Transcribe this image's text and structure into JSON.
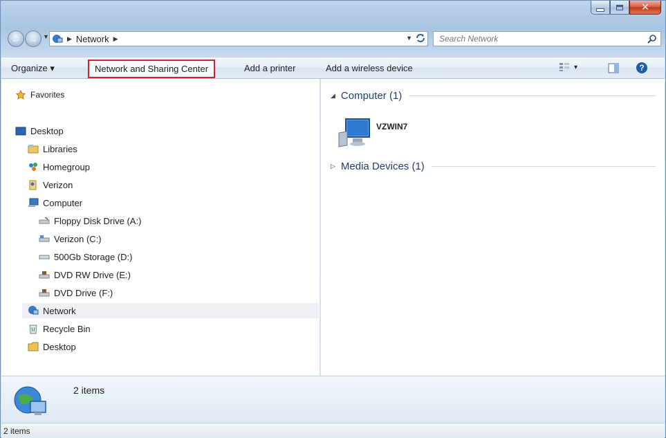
{
  "window": {
    "caption": {
      "minimize": "minimize",
      "maximize": "maximize",
      "close_glyph": "✕"
    }
  },
  "address": {
    "path": [
      "Network"
    ],
    "search_placeholder": "Search Network"
  },
  "toolbar": {
    "organize": "Organize ▾",
    "network_sharing": "Network and Sharing Center",
    "add_printer": "Add a printer",
    "add_wireless": "Add a wireless device",
    "views_arrow": "▾",
    "help": "?"
  },
  "nav": {
    "favorites": "Favorites",
    "items": [
      {
        "label": "Desktop"
      },
      {
        "label": "Libraries"
      },
      {
        "label": "Homegroup"
      },
      {
        "label": "Verizon"
      },
      {
        "label": "Computer"
      },
      {
        "label": "Floppy Disk Drive (A:)"
      },
      {
        "label": "Verizon (C:)"
      },
      {
        "label": "500Gb Storage (D:)"
      },
      {
        "label": "DVD RW Drive (E:)"
      },
      {
        "label": "DVD Drive (F:)"
      },
      {
        "label": "Network"
      },
      {
        "label": "Recycle Bin"
      },
      {
        "label": "Desktop"
      }
    ]
  },
  "content": {
    "groups": [
      {
        "label": "Computer (1)",
        "expanded": true
      },
      {
        "label": "Media Devices (1)",
        "expanded": false
      }
    ],
    "computer": "VZWIN7"
  },
  "details": {
    "count": "2 items"
  },
  "status": {
    "text": "2 items"
  },
  "colors": {
    "highlight_border": "#d32228",
    "selected_bg": "#eef1f5"
  }
}
